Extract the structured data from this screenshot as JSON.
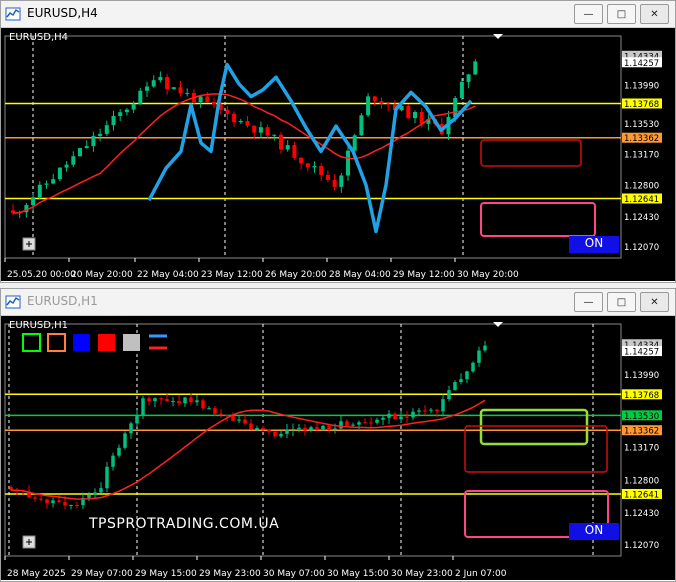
{
  "window1": {
    "title": "EURUSD,H4",
    "symbol": "EURUSD,H4",
    "prices": [
      "1.14334",
      "1.14257",
      "1.13990",
      "1.13768",
      "1.13530",
      "1.13362",
      "1.13170",
      "1.12800",
      "1.12641",
      "1.12430",
      "1.12070"
    ],
    "highlighted": {
      "1.14334": "#c8c8c8",
      "1.14257": "#ffffff",
      "1.13768": "#ffff00",
      "1.13362": "#ff9933",
      "1.12641": "#ffff00"
    },
    "time_labels": [
      "25.05.20 00:00",
      "20 May 20:00",
      "22 May 04:00",
      "23 May 12:00",
      "26 May 20:00",
      "28 May 04:00",
      "29 May 12:00",
      "30 May 20:00"
    ],
    "on_label": "ON"
  },
  "window2": {
    "title": "EURUSD,H1",
    "symbol": "EURUSD,H1",
    "prices": [
      "1.14334",
      "1.14257",
      "1.13990",
      "1.13768",
      "1.13530",
      "1.13362",
      "1.13170",
      "1.12800",
      "1.12641",
      "1.12430",
      "1.12070"
    ],
    "time_labels": [
      "28 May 2025",
      "29 May 07:00",
      "29 May 15:00",
      "29 May 23:00",
      "30 May 07:00",
      "30 May 15:00",
      "30 May 23:00",
      "2 Jun 07:00"
    ],
    "watermark": "TPSPROTRADING.COM.UA",
    "on_label": "ON",
    "toolbar_colors": [
      "#00ff00",
      "#ff8040",
      "#0000ff",
      "#ff0000",
      "#c0c0c0"
    ]
  },
  "colors": {
    "bull": "#00c080",
    "bear": "#ff0000",
    "yellow": "#ffff00",
    "orange": "#ff9933",
    "green": "#00cc44",
    "blue_line": "#1fa3e6",
    "ma_red": "#ff2020"
  }
}
